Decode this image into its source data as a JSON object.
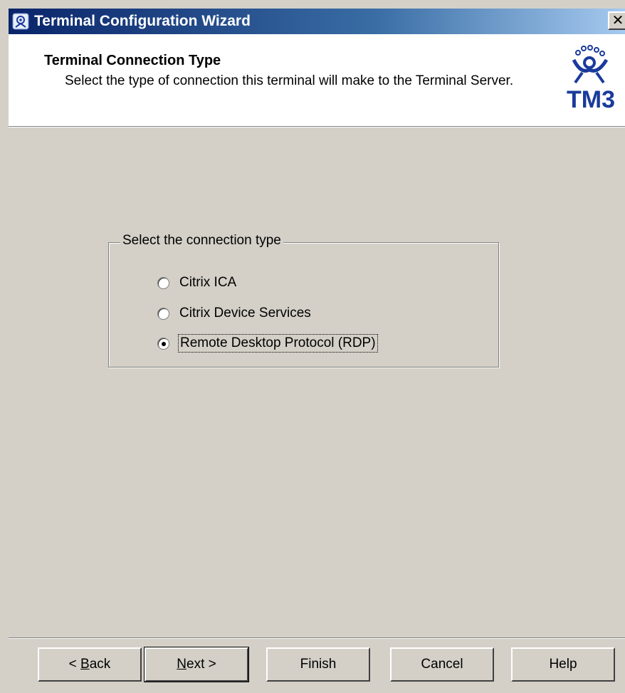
{
  "window": {
    "title": "Terminal Configuration Wizard",
    "close_label": "✕"
  },
  "header": {
    "title": "Terminal Connection Type",
    "description": "Select the type of connection this terminal will make to the Terminal Server.",
    "logo_text": "TM3"
  },
  "group": {
    "legend": "Select the connection type",
    "options": [
      {
        "label": "Citrix ICA",
        "selected": false
      },
      {
        "label": "Citrix Device Services",
        "selected": false
      },
      {
        "label": "Remote Desktop Protocol (RDP)",
        "selected": true
      }
    ]
  },
  "buttons": {
    "back": {
      "prefix": "< ",
      "mnemonic": "B",
      "rest": "ack"
    },
    "next": {
      "mnemonic": "N",
      "rest": "ext >"
    },
    "finish": "Finish",
    "cancel": "Cancel",
    "help": "Help"
  },
  "colors": {
    "titlebar_start": "#0a246a",
    "titlebar_end": "#a6caf0",
    "face": "#d4d0c8",
    "logo_blue": "#1a3a9c"
  }
}
